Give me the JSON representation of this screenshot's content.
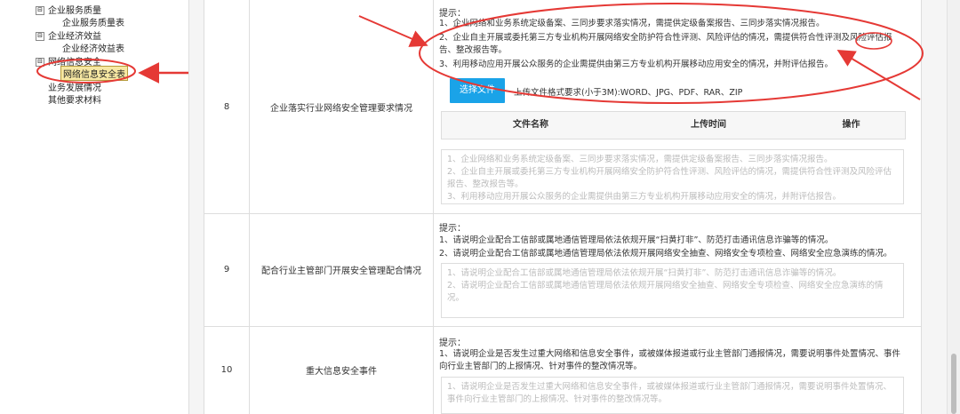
{
  "sidebar": {
    "nodes": [
      {
        "label": "企业服务质量",
        "toggle": "⊟"
      },
      {
        "label": "企业经济效益",
        "toggle": "⊟"
      },
      {
        "label": "网络信息安全",
        "toggle": "⊟"
      }
    ],
    "children": {
      "service_quality": "企业服务质量表",
      "economic": "企业经济效益表",
      "netsec": "网络信息安全表"
    },
    "leaves": [
      "业务发展情况",
      "其他要求材料"
    ]
  },
  "rows": [
    {
      "num": "8",
      "name": "企业落实行业网络安全管理要求情况",
      "hint_title": "提示：",
      "hints": [
        "1、企业网络和业务系统定级备案、三同步要求落实情况，需提供定级备案报告、三同步落实情况报告。",
        "2、企业自主开展或委托第三方专业机构开展网络安全防护符合性评测、风险评估的情况，需提供符合性评测及风险评估报告、整改报告等。",
        "3、利用移动应用开展公众服务的企业需提供由第三方专业机构开展移动应用安全的情况，并附评估报告。"
      ],
      "upload_label": "选择文件",
      "upload_tip": "上传文件格式要求(小于3M):WORD、JPG、PDF、RAR、ZIP",
      "file_headers": [
        "文件名称",
        "上传时间",
        "操作"
      ],
      "placeholder": "1、企业网络和业务系统定级备案、三同步要求落实情况，需提供定级备案报告、三同步落实情况报告。\n2、企业自主开展或委托第三方专业机构开展网络安全防护符合性评测、风险评估的情况，需提供符合性评测及风险评估报告、整改报告等。\n3、利用移动应用开展公众服务的企业需提供由第三方专业机构开展移动应用安全的情况，并附评估报告。"
    },
    {
      "num": "9",
      "name": "配合行业主管部门开展安全管理配合情况",
      "hint_title": "提示：",
      "hints": [
        "1、请说明企业配合工信部或属地通信管理局依法依规开展“扫黄打非”、防范打击通讯信息诈骗等的情况。",
        "2、请说明企业配合工信部或属地通信管理局依法依规开展网络安全抽查、网络安全专项检查、网络安全应急演练的情况。"
      ],
      "placeholder": "1、请说明企业配合工信部或属地通信管理局依法依规开展“扫黄打非”、防范打击通讯信息诈骗等的情况。\n2、请说明企业配合工信部或属地通信管理局依法依规开展网络安全抽查、网络安全专项检查、网络安全应急演练的情况。"
    },
    {
      "num": "10",
      "name": "重大信息安全事件",
      "hint_title": "提示：",
      "hints": [
        "1、请说明企业是否发生过重大网络和信息安全事件，或被媒体报道或行业主管部门通报情况，需要说明事件处置情况、事件向行业主管部门的上报情况、针对事件的整改情况等。"
      ],
      "placeholder": "1、请说明企业是否发生过重大网络和信息安全事件，或被媒体报道或行业主管部门通报情况，需要说明事件处置情况、事件向行业主管部门的上报情况、针对事件的整改情况等。"
    }
  ],
  "colors": {
    "accent": "#1aa3e8",
    "annotation": "#e53935",
    "selected": "#f7e8a3"
  }
}
